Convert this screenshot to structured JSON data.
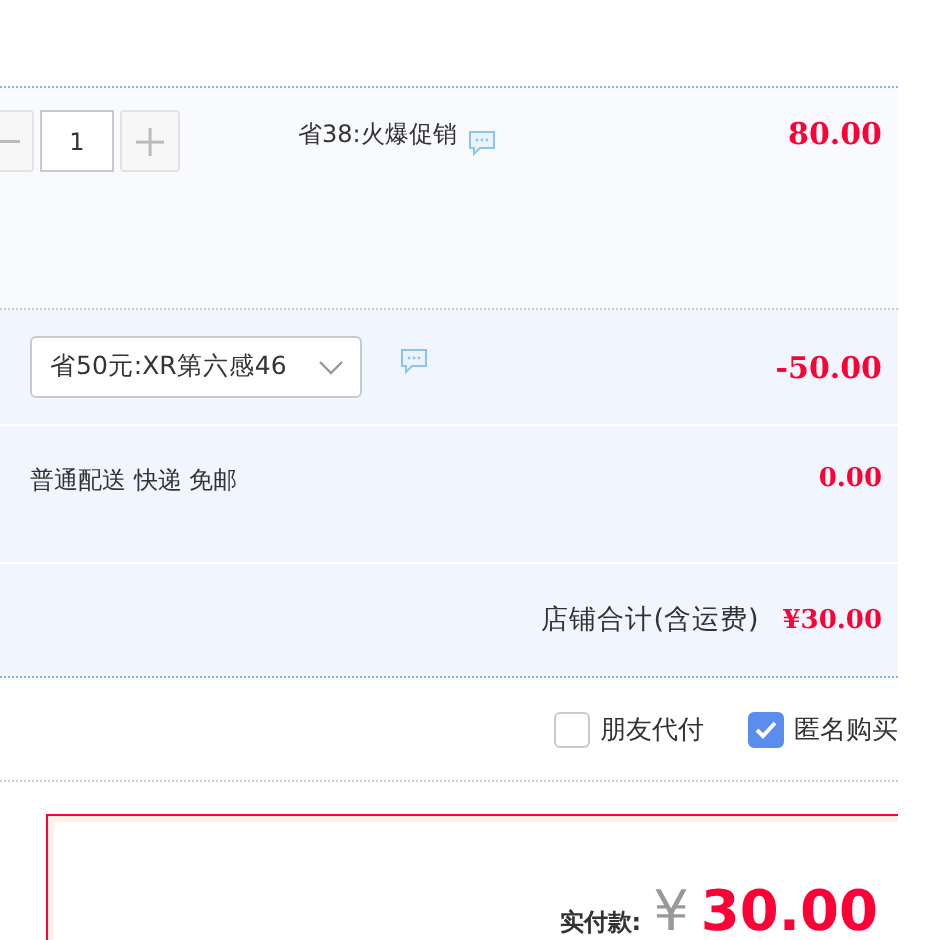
{
  "item": {
    "quantity": "1",
    "promotion": "省38:火爆促销",
    "price": "80.00"
  },
  "coupon": {
    "value": "省50元:XR第六感46",
    "amount": "-50.00"
  },
  "shipping": {
    "label": "普通配送 快递 免邮",
    "amount": "0.00"
  },
  "shop_total": {
    "label": "店铺合计(含运费)",
    "amount": "¥30.00"
  },
  "options": [
    {
      "label": "朋友代付",
      "checked": false
    },
    {
      "label": "匿名购买",
      "checked": true
    }
  ],
  "payment": {
    "label": "实付款:",
    "currency": "¥",
    "amount": "30.00"
  }
}
